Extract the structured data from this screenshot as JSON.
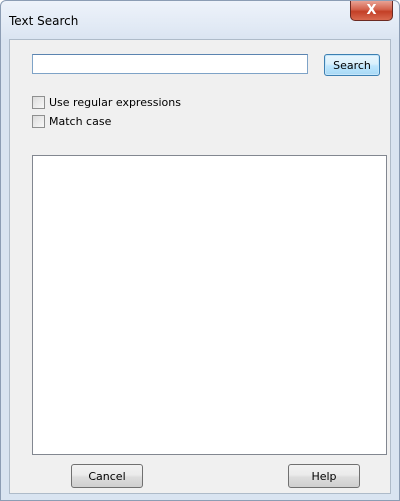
{
  "window": {
    "title": "Text Search",
    "close_glyph": "X"
  },
  "search": {
    "value": "",
    "placeholder": "",
    "button_label": "Search"
  },
  "options": {
    "regex_label": "Use regular expressions",
    "regex_checked": false,
    "match_case_label": "Match case",
    "match_case_checked": false
  },
  "results": {
    "items": []
  },
  "footer": {
    "cancel_label": "Cancel",
    "help_label": "Help"
  },
  "colors": {
    "close_button": "#c94a32",
    "search_button_border": "#3c7fb1",
    "dialog_background": "#f0f0f0"
  }
}
